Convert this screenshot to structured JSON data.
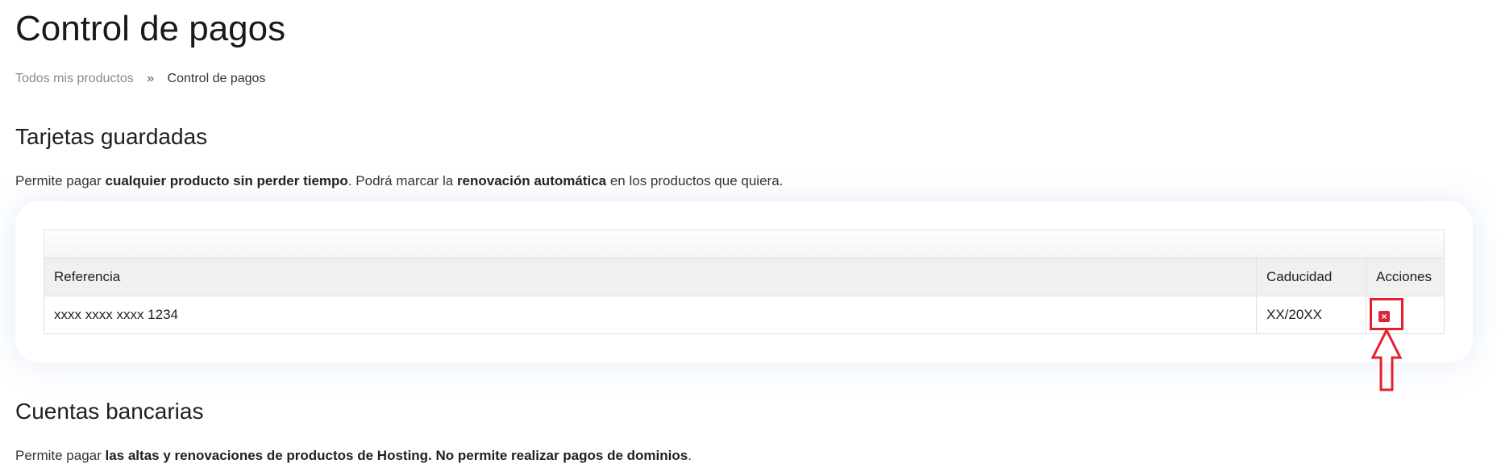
{
  "page": {
    "title": "Control de pagos"
  },
  "breadcrumb": {
    "items": [
      {
        "label": "Todos mis productos"
      },
      {
        "label": "Control de pagos"
      }
    ],
    "separator": "»"
  },
  "cards_section": {
    "title": "Tarjetas guardadas",
    "desc_1": "Permite pagar ",
    "desc_2": "cualquier producto sin perder tiempo",
    "desc_3": ". Podrá marcar la ",
    "desc_4": "renovación automática",
    "desc_5": " en los productos que quiera.",
    "table": {
      "columns": [
        "Referencia",
        "Caducidad",
        "Acciones"
      ],
      "rows": [
        {
          "reference": "xxxx xxxx xxxx 1234",
          "expiry": "XX/20XX",
          "action_icon": "delete-x-icon"
        }
      ]
    }
  },
  "bank_section": {
    "title": "Cuentas bancarias",
    "desc_1": "Permite pagar ",
    "desc_2": "las altas y renovaciones de productos de Hosting. No permite realizar pagos de dominios",
    "desc_3": "."
  },
  "annotation": {
    "color": "#e3202c"
  },
  "colors": {
    "delete": "#d9263a",
    "text": "#222222",
    "muted": "#8a8a8a"
  }
}
